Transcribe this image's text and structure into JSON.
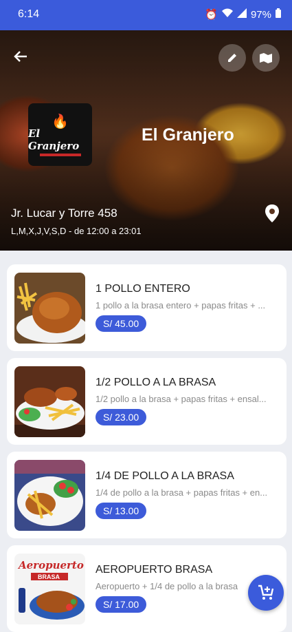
{
  "status_bar": {
    "time": "6:14",
    "battery": "97%"
  },
  "restaurant": {
    "name": "El Granjero",
    "logo_text": "El Granjero",
    "address": "Jr. Lucar y Torre 458",
    "hours": "L,M,X,J,V,S,D - de 12:00 a 23:01"
  },
  "icons": {
    "back": "arrow-left-icon",
    "edit": "pencil-icon",
    "map": "map-icon",
    "location": "location-pin-icon",
    "cart": "add-to-cart-icon"
  },
  "menu": [
    {
      "title": "1 POLLO ENTERO",
      "description": "1 pollo a la brasa entero + papas fritas + ...",
      "price": "S/ 45.00"
    },
    {
      "title": "1/2 POLLO A LA BRASA",
      "description": "1/2 pollo a la brasa + papas fritas + ensal...",
      "price": "S/ 23.00"
    },
    {
      "title": "1/4 DE POLLO A LA BRASA",
      "description": "1/4 de pollo a la brasa + papas fritas + en...",
      "price": "S/ 13.00"
    },
    {
      "title": "AEROPUERTO BRASA",
      "description": "Aeropuerto + 1/4 de pollo a la brasa",
      "price": "S/ 17.00",
      "thumb_text_1": "Aeropuerto",
      "thumb_text_2": "BRASA"
    }
  ],
  "colors": {
    "primary": "#3b5bdb",
    "price_badge": "#3d5bd9"
  }
}
